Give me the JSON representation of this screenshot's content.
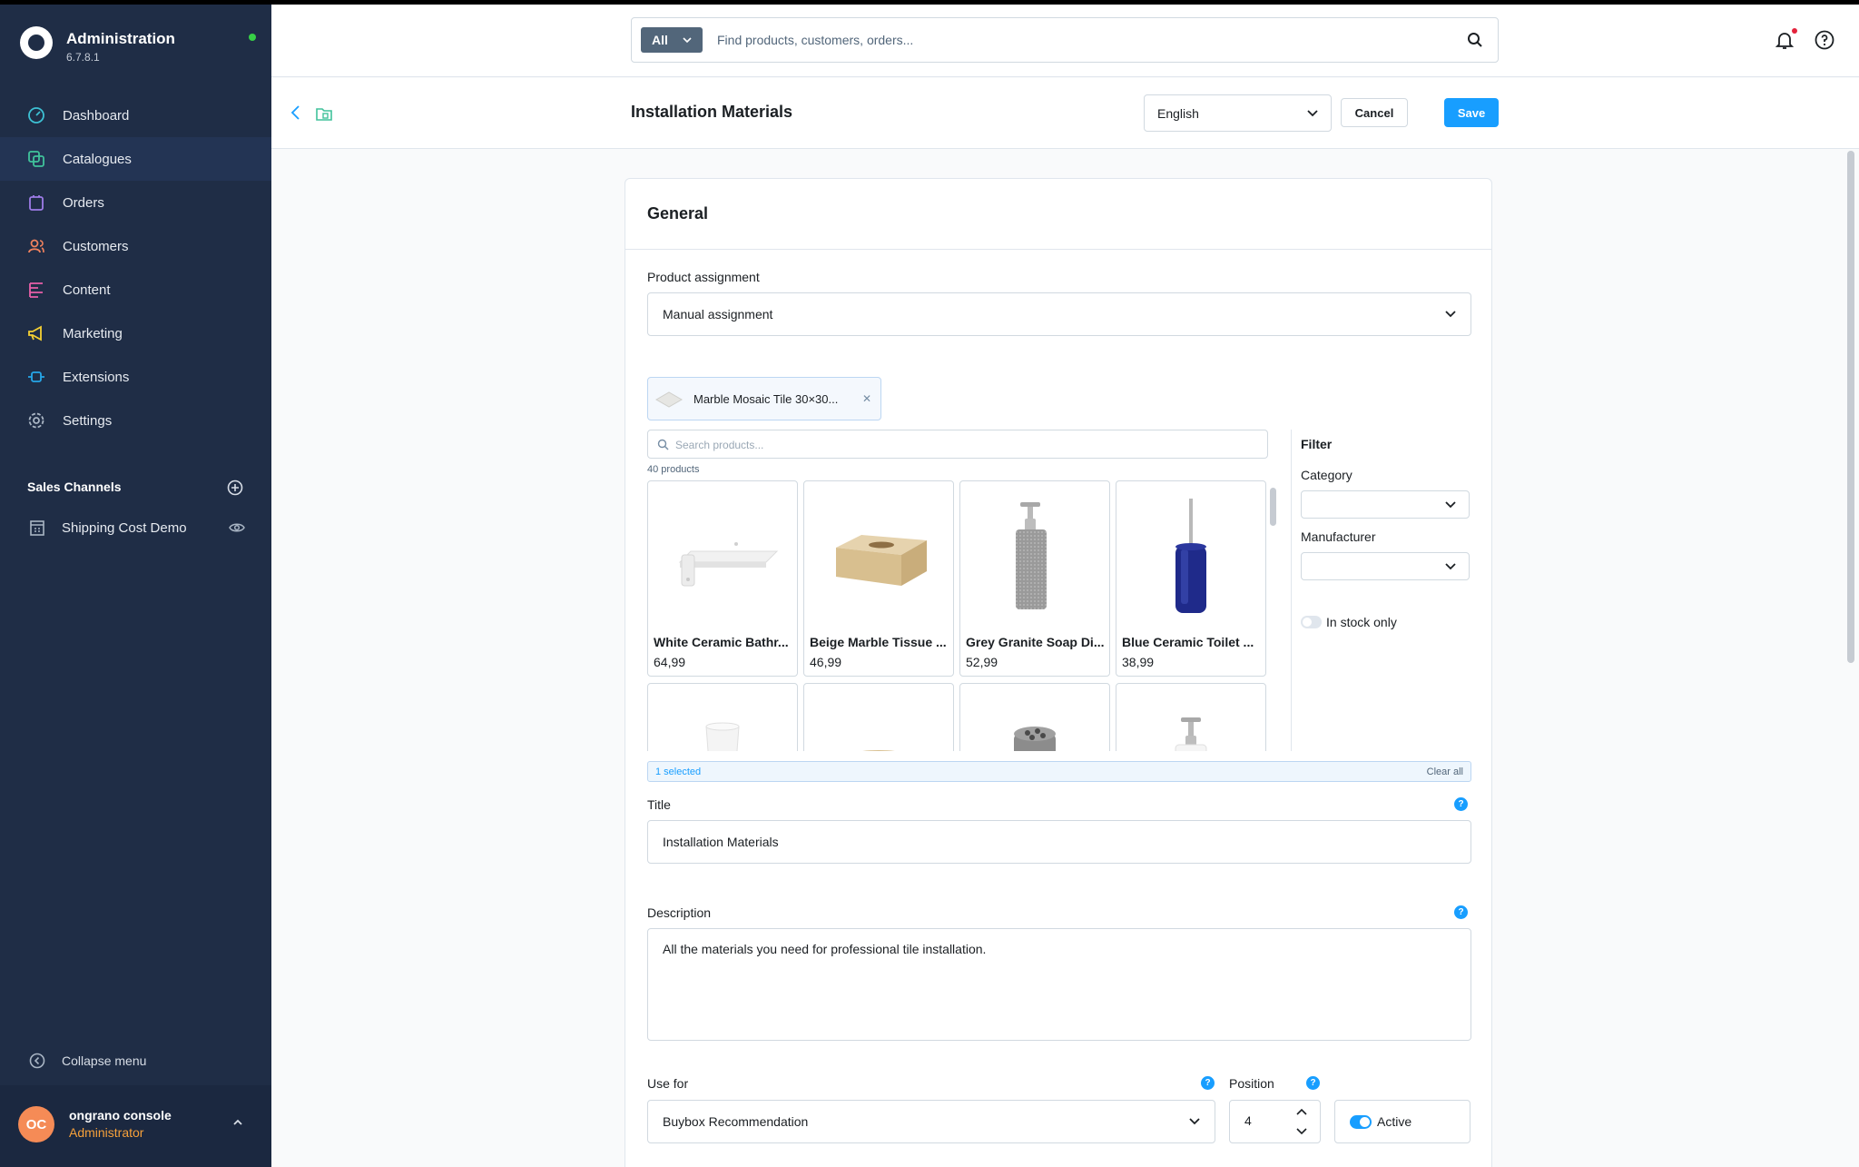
{
  "app": {
    "title": "Administration",
    "version": "6.7.8.1"
  },
  "nav": {
    "items": [
      {
        "label": "Dashboard",
        "icon": "dashboard-icon"
      },
      {
        "label": "Catalogues",
        "icon": "catalogues-icon"
      },
      {
        "label": "Orders",
        "icon": "orders-icon"
      },
      {
        "label": "Customers",
        "icon": "customers-icon"
      },
      {
        "label": "Content",
        "icon": "content-icon"
      },
      {
        "label": "Marketing",
        "icon": "marketing-icon"
      },
      {
        "label": "Extensions",
        "icon": "extensions-icon"
      },
      {
        "label": "Settings",
        "icon": "settings-icon"
      }
    ],
    "active_index": 1
  },
  "sales_channels": {
    "title": "Sales Channels",
    "items": [
      {
        "label": "Shipping Cost Demo"
      }
    ]
  },
  "collapse_label": "Collapse menu",
  "user": {
    "initials": "OC",
    "name": "ongrano console",
    "role": "Administrator"
  },
  "search": {
    "type_label": "All",
    "placeholder": "Find products, customers, orders..."
  },
  "smartbar": {
    "title": "Installation Materials",
    "language": "English",
    "cancel_label": "Cancel",
    "save_label": "Save"
  },
  "general": {
    "title": "General",
    "product_assignment_label": "Product assignment",
    "product_assignment_value": "Manual assignment",
    "selected_chip": "Marble Mosaic Tile 30×30...",
    "product_search_placeholder": "Search products...",
    "product_count": "40 products",
    "products": [
      {
        "name": "White Ceramic Bathr...",
        "price": "64,99"
      },
      {
        "name": "Beige Marble Tissue ...",
        "price": "46,99"
      },
      {
        "name": "Grey Granite Soap Di...",
        "price": "52,99"
      },
      {
        "name": "Blue Ceramic Toilet ...",
        "price": "38,99"
      }
    ],
    "filter": {
      "title": "Filter",
      "category_label": "Category",
      "manufacturer_label": "Manufacturer",
      "in_stock_label": "In stock only"
    },
    "selection": {
      "count_label": "1 selected",
      "clear_label": "Clear all"
    },
    "title_label": "Title",
    "title_value": "Installation Materials",
    "description_label": "Description",
    "description_value": "All the materials you need for professional tile installation.",
    "use_for_label": "Use for",
    "use_for_value": "Buybox Recommendation",
    "position_label": "Position",
    "position_value": "4",
    "active_label": "Active",
    "help_glyph": "?"
  },
  "colors": {
    "sidebar_bg": "#1f2d46",
    "primary": "#189eff",
    "status_online": "#37d046",
    "role_text": "#f7a13a",
    "avatar": "#f58b56"
  }
}
